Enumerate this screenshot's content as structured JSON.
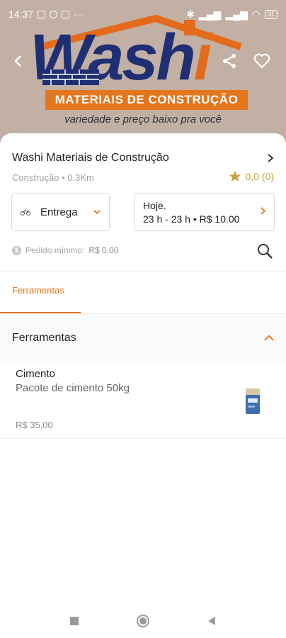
{
  "status_bar": {
    "time": "14:37",
    "battery": "31"
  },
  "header": {
    "logo_text_1": "Wash",
    "logo_text_2": "i",
    "logo_subtitle": "MATERIAIS DE CONSTRUÇÃO",
    "tagline": "variedade e preço baixo pra você"
  },
  "store": {
    "name": "Washi Materiais de Construção",
    "category_distance": "Construção • 0.3Km",
    "rating": "0,0 (0)"
  },
  "delivery": {
    "mode": "Entrega"
  },
  "schedule": {
    "day": "Hoje.",
    "details": "23 h - 23 h • R$ 10.00"
  },
  "minimum_order": {
    "label": "Pedido mínimo:",
    "value": "R$ 0.00"
  },
  "tabs": [
    {
      "label": "Ferramentas"
    }
  ],
  "section": {
    "title": "Ferramentas"
  },
  "products": [
    {
      "name": "Cimento",
      "description": "Pacote de cimento 50kg",
      "price": "R$ 35,00"
    }
  ],
  "colors": {
    "accent": "#e4761e",
    "brand_blue": "#1f2f74",
    "banner_bg": "#c3b0a4",
    "star": "#c9a13b"
  }
}
